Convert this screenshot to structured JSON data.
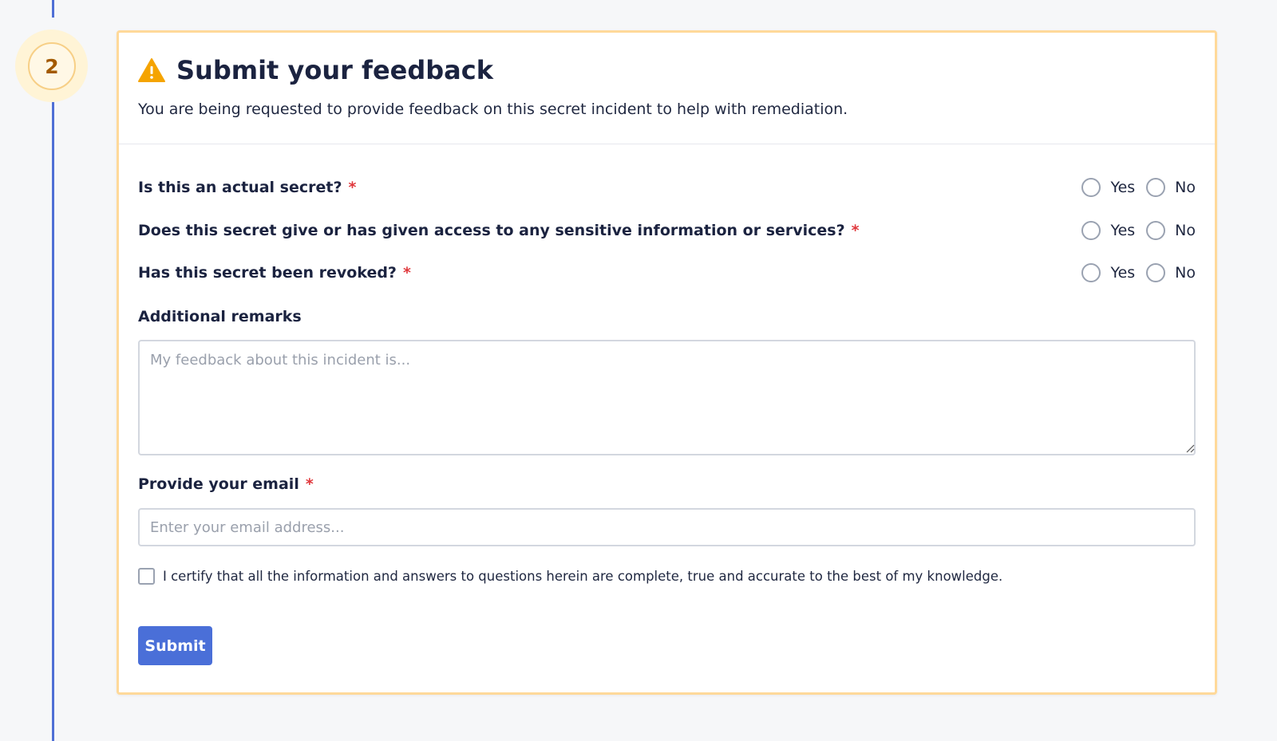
{
  "step": {
    "number": "2"
  },
  "header": {
    "title": "Submit your feedback",
    "subtitle": "You are being requested to provide feedback on this secret incident to help with remediation."
  },
  "questions": [
    {
      "label": "Is this an actual secret?",
      "required": "*",
      "yes": "Yes",
      "no": "No"
    },
    {
      "label": "Does this secret give or has given access to any sensitive information or services?",
      "required": "*",
      "yes": "Yes",
      "no": "No"
    },
    {
      "label": "Has this secret been revoked?",
      "required": "*",
      "yes": "Yes",
      "no": "No"
    }
  ],
  "remarks": {
    "label": "Additional remarks",
    "placeholder": "My feedback about this incident is..."
  },
  "email": {
    "label": "Provide your email",
    "required": "*",
    "placeholder": "Enter your email address..."
  },
  "certify": {
    "text": "I certify that all the information and answers to questions herein are complete, true and accurate to the best of my knowledge."
  },
  "submit": {
    "label": "Submit"
  },
  "colors": {
    "accent": "#4a6fd8",
    "warning": "#f5a400",
    "required": "#e0383c",
    "card_border": "#ffd99a"
  }
}
